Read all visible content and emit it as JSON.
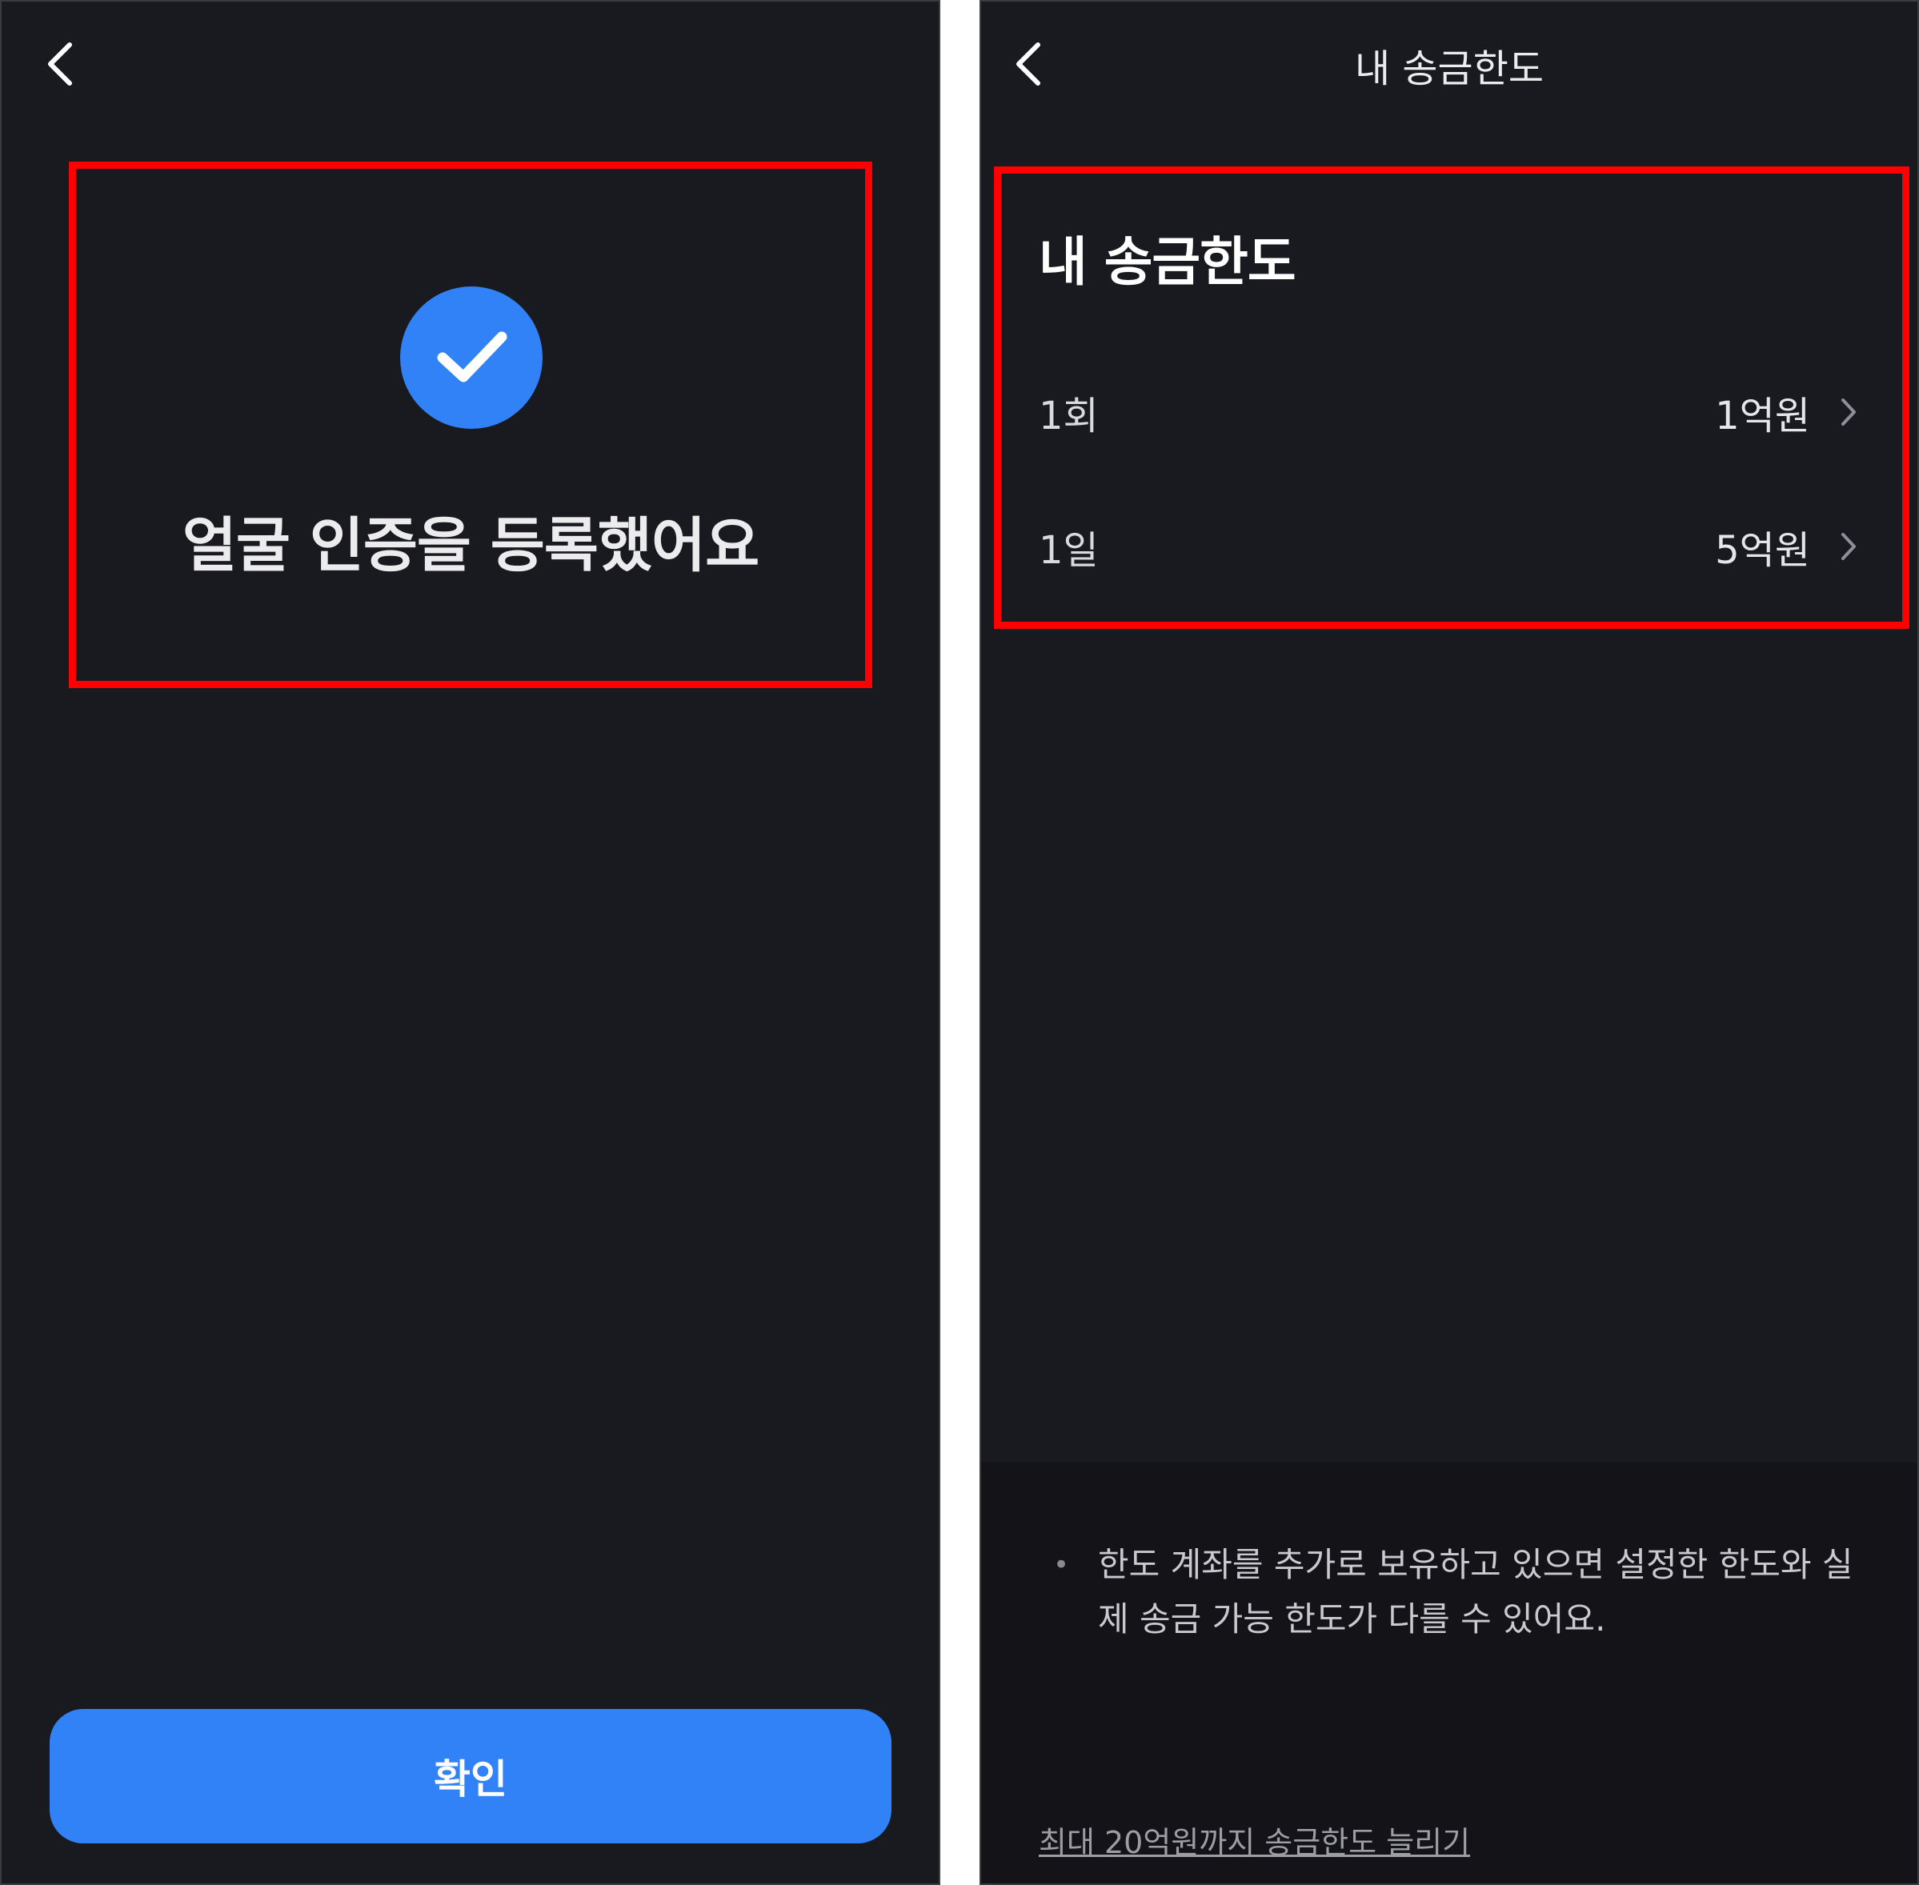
{
  "left_screen": {
    "success_message": "얼굴 인증을 등록했어요",
    "confirm_label": "확인"
  },
  "right_screen": {
    "header_title": "내 송금한도",
    "section_title": "내 송금한도",
    "limits": [
      {
        "label": "1회",
        "value": "1억원"
      },
      {
        "label": "1일",
        "value": "5억원"
      }
    ],
    "notice": "한도 계좌를 추가로 보유하고 있으면 설정한 한도와 실제 송금 가능 한도가 다를 수 있어요.",
    "bullet": "•",
    "increase_link": "최대 20억원까지 송금한도 늘리기"
  },
  "colors": {
    "background": "#191a20",
    "accent": "#3182f6",
    "highlight": "#ff0000",
    "footer": "#141418"
  },
  "icons": {
    "back": "chevron-left-icon",
    "check": "check-circle-icon",
    "row_arrow": "chevron-right-icon"
  }
}
